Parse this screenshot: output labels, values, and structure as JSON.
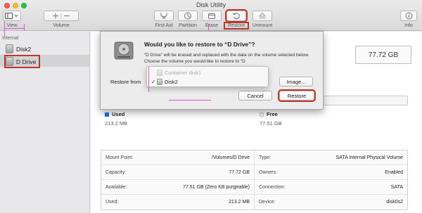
{
  "window": {
    "title": "Disk Utility"
  },
  "toolbar": {
    "view_label": "View",
    "volume_label": "Volume",
    "first_aid_label": "First Aid",
    "partition_label": "Partition",
    "erase_label": "Erase",
    "restore_label": "Restore",
    "unmount_label": "Unmount",
    "info_label": "Info"
  },
  "sidebar": {
    "section": "Internal",
    "items": [
      {
        "label": "Disk2"
      },
      {
        "label": "D Drive"
      }
    ]
  },
  "volume": {
    "capacity_badge": "77.72 GB",
    "used_label": "Used",
    "used_value": "213.2 MB",
    "free_label": "Free",
    "free_value": "77.51 GB"
  },
  "info": {
    "rows": [
      {
        "k1": "Mount Point:",
        "v1": "/Volumes/D Drive",
        "k2": "Type:",
        "v2": "SATA Internal Physical Volume"
      },
      {
        "k1": "Capacity:",
        "v1": "77.72 GB",
        "k2": "Owners:",
        "v2": "Enabled"
      },
      {
        "k1": "Available:",
        "v1": "77.51 GB (Zero KB purgeable)",
        "k2": "Connection:",
        "v2": "SATA"
      },
      {
        "k1": "Used:",
        "v1": "213.2 MB",
        "k2": "Device:",
        "v2": "disk0s2"
      }
    ]
  },
  "dialog": {
    "title": "Would you like to restore to “D Drive”?",
    "message": "“D Drive” will be erased and replaced with the data on the volume selected below. Choose the volume you would like to restore to “D",
    "restore_from_label": "Restore from",
    "image_button": "Image...",
    "cancel_button": "Cancel",
    "restore_button": "Restore"
  },
  "popup": {
    "options": [
      {
        "label": "Container disk1",
        "enabled": false,
        "checked": false
      },
      {
        "label": "Disk2",
        "enabled": true,
        "checked": true
      }
    ],
    "checkmark": "✓"
  },
  "colors": {
    "used": "#1a73e8",
    "free": "#f2f2f2",
    "highlight": "#c0362c",
    "annotation": "#e64fd3"
  }
}
